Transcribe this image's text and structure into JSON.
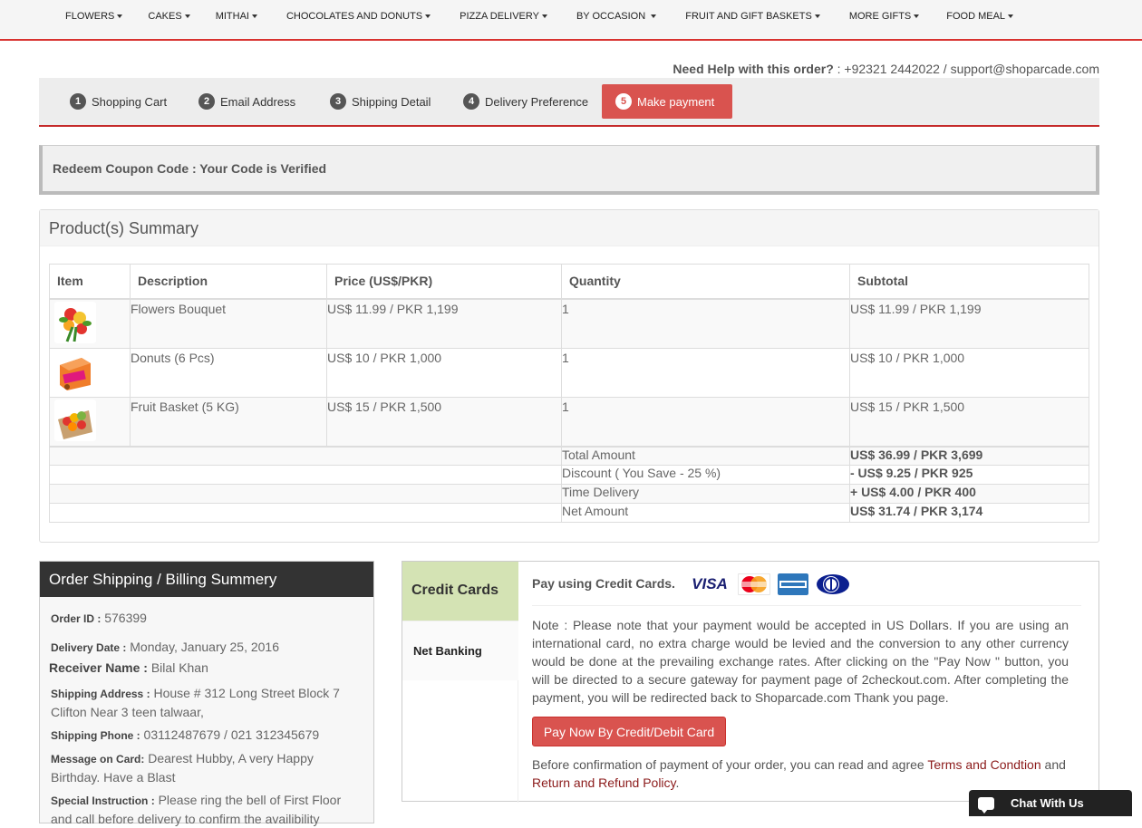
{
  "nav": {
    "items": [
      {
        "label": "FLOWERS"
      },
      {
        "label": "CAKES"
      },
      {
        "label": "MITHAI"
      },
      {
        "label": "CHOCOLATES AND DONUTS"
      },
      {
        "label": "PIZZA DELIVERY"
      },
      {
        "label": "BY OCCASION"
      },
      {
        "label": "FRUIT AND GIFT BASKETS"
      },
      {
        "label": "MORE GIFTS"
      },
      {
        "label": "FOOD MEAL"
      }
    ]
  },
  "help": {
    "label": "Need Help with this order?",
    "contact": " : +92321 2442022 / support@shoparcade.com"
  },
  "steps": [
    {
      "num": "1",
      "label": "Shopping Cart"
    },
    {
      "num": "2",
      "label": "Email Address"
    },
    {
      "num": "3",
      "label": "Shipping Detail"
    },
    {
      "num": "4",
      "label": "Delivery Preference"
    },
    {
      "num": "5",
      "label": "Make payment"
    }
  ],
  "coupon": {
    "text": "Redeem Coupon Code : Your Code is Verified"
  },
  "summary": {
    "title": "Product(s) Summary",
    "columns": [
      "Item",
      "Description",
      "Price (US$/PKR)",
      "Quantity",
      "Subtotal"
    ],
    "rows": [
      {
        "description": "Flowers Bouquet",
        "price": "US$ 11.99 / PKR 1,199",
        "quantity": "1",
        "subtotal": "US$ 11.99 / PKR 1,199"
      },
      {
        "description": "Donuts (6 Pcs)",
        "price": "US$ 10 / PKR 1,000",
        "quantity": "1",
        "subtotal": "US$ 10 / PKR 1,000"
      },
      {
        "description": "Fruit Basket (5 KG)",
        "price": "US$ 15 / PKR 1,500",
        "quantity": "1",
        "subtotal": "US$ 15 / PKR 1,500"
      }
    ],
    "totals": [
      {
        "label": "Total Amount",
        "value": "US$ 36.99 / PKR 3,699"
      },
      {
        "label": "Discount ( You Save - 25 %)",
        "value": "- US$ 9.25 / PKR 925"
      },
      {
        "label": "Time Delivery",
        "value": "+ US$ 4.00 / PKR 400"
      },
      {
        "label": "Net Amount",
        "value": "US$ 31.74 / PKR 3,174"
      }
    ]
  },
  "billing": {
    "title": "Order Shipping / Billing Summery",
    "order_id_label": "Order ID :",
    "order_id": " 576399",
    "delivery_date_label": "Delivery Date :",
    "delivery_date": " Monday, January 25, 2016",
    "receiver_label": "Receiver Name :",
    "receiver": " Bilal Khan",
    "address_label": "Shipping Address :",
    "address": " House # 312 Long Street Block 7 Clifton Near 3 teen talwaar,",
    "phone_label": "Shipping Phone :",
    "phone": " 03112487679 / 021 312345679",
    "message_label": "Message on Card:",
    "message": " Dearest Hubby, A very Happy Birthday. Have a Blast",
    "instruction_label": "Special Instruction :",
    "instruction": " Please ring the bell of First Floor and call before delivery to confirm the availibility"
  },
  "payment": {
    "tab_credit": "Credit Cards",
    "tab_netbanking": "Net Banking",
    "title": "Pay using Credit Cards.",
    "cards": [
      "VISA",
      "MasterCard",
      "AMEX",
      "Diners"
    ],
    "note": "Note : Please note that your payment would be accepted in US Dollars. If you are using an international card, no extra charge would be levied and the conversion to any other currency would be done at the prevailing exchange rates. After clicking on the \"Pay Now \" button, you will be directed to a secure gateway for payment page of 2checkout.com. After completing the payment, you will be redirected back to Shoparcade.com Thank you page.",
    "button": "Pay Now By Credit/Debit Card",
    "confirm_text": "Before confirmation of payment of your order, you can read and agree ",
    "terms_link": "Terms and Condtion",
    "and_text": " and ",
    "refund_link": "Return and Refund Policy",
    "end": "."
  },
  "chat": {
    "label": "Chat With Us"
  },
  "colors": {
    "accent": "#d9534f",
    "cc_tab": "#d4e3b4",
    "dark_header": "#333333"
  }
}
